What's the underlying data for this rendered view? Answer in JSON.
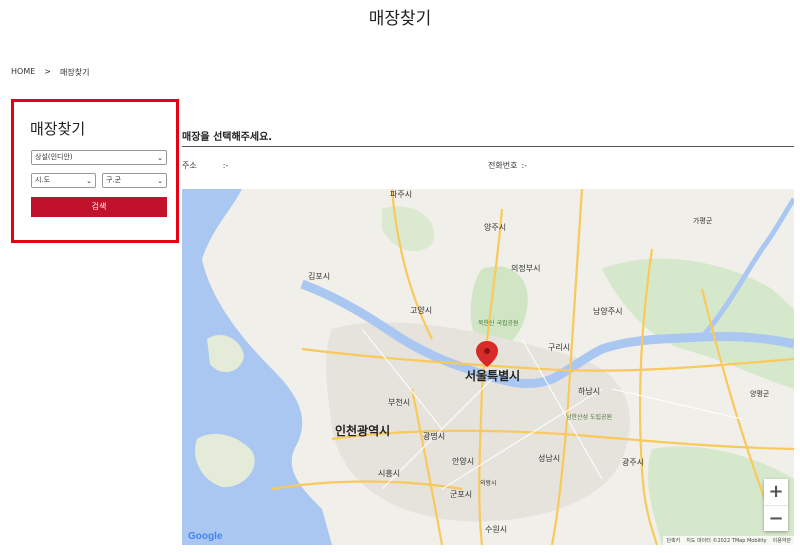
{
  "page": {
    "title": "매장찾기"
  },
  "breadcrumb": {
    "home": "HOME",
    "separator": ">",
    "current": "매장찾기"
  },
  "search_panel": {
    "title": "매장찾기",
    "store_select": {
      "value": "상설(인디안)"
    },
    "sido_select": {
      "value": "시.도"
    },
    "gugun_select": {
      "value": "구.군"
    },
    "search_button": "검색",
    "accent_color": "#e60012",
    "button_color": "#c0122b"
  },
  "store_info": {
    "heading": "매장을 선택해주세요.",
    "address_label": "주소",
    "address_value": ":-",
    "phone_label": "전화번호",
    "phone_value": ":-"
  },
  "map": {
    "labels": {
      "paju": "파주시",
      "yangju": "양주시",
      "uijeongbu": "의정부시",
      "gimpo": "김포시",
      "goyang": "고양시",
      "namyangju": "남양주시",
      "gapyeong": "가평군",
      "bukhansan": "북한산 국립공원",
      "guri": "구리시",
      "seoul": "서울특별시",
      "hanam": "하남시",
      "yangpyeong": "양평군",
      "bucheon": "부천시",
      "incheon": "인천광역시",
      "namhansanseong": "남한산성 도립공원",
      "gwangmyeong": "광명시",
      "seongnam": "성남시",
      "gwangju": "광주시",
      "anyang": "안양시",
      "siheung": "시흥시",
      "uiwang": "의왕시",
      "gunpo": "군포시",
      "suwon": "수원시"
    },
    "zoom_in": "+",
    "zoom_out": "−",
    "attribution": {
      "shortcuts": "단축키",
      "data": "지도 데이터 ©2022 TMap Mobility",
      "terms": "이용약관"
    },
    "google_logo": "Google",
    "colors": {
      "land": "#f1efe9",
      "water": "#a9c7f0",
      "park": "#cfe5c4",
      "urban": "#e8e6e1",
      "road": "#f9c95b",
      "pin": "#d92a2a"
    }
  }
}
